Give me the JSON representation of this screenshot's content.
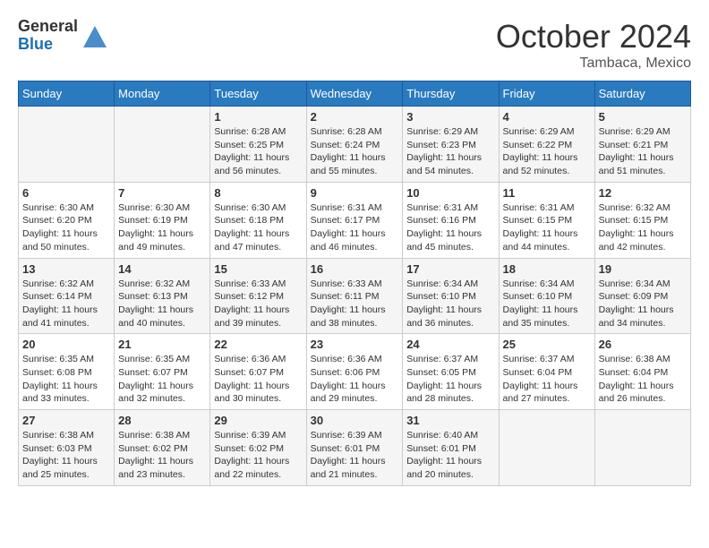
{
  "logo": {
    "general": "General",
    "blue": "Blue"
  },
  "title": "October 2024",
  "location": "Tambaca, Mexico",
  "days_of_week": [
    "Sunday",
    "Monday",
    "Tuesday",
    "Wednesday",
    "Thursday",
    "Friday",
    "Saturday"
  ],
  "weeks": [
    [
      {
        "day": "",
        "sunrise": "",
        "sunset": "",
        "daylight": ""
      },
      {
        "day": "",
        "sunrise": "",
        "sunset": "",
        "daylight": ""
      },
      {
        "day": "1",
        "sunrise": "Sunrise: 6:28 AM",
        "sunset": "Sunset: 6:25 PM",
        "daylight": "Daylight: 11 hours and 56 minutes."
      },
      {
        "day": "2",
        "sunrise": "Sunrise: 6:28 AM",
        "sunset": "Sunset: 6:24 PM",
        "daylight": "Daylight: 11 hours and 55 minutes."
      },
      {
        "day": "3",
        "sunrise": "Sunrise: 6:29 AM",
        "sunset": "Sunset: 6:23 PM",
        "daylight": "Daylight: 11 hours and 54 minutes."
      },
      {
        "day": "4",
        "sunrise": "Sunrise: 6:29 AM",
        "sunset": "Sunset: 6:22 PM",
        "daylight": "Daylight: 11 hours and 52 minutes."
      },
      {
        "day": "5",
        "sunrise": "Sunrise: 6:29 AM",
        "sunset": "Sunset: 6:21 PM",
        "daylight": "Daylight: 11 hours and 51 minutes."
      }
    ],
    [
      {
        "day": "6",
        "sunrise": "Sunrise: 6:30 AM",
        "sunset": "Sunset: 6:20 PM",
        "daylight": "Daylight: 11 hours and 50 minutes."
      },
      {
        "day": "7",
        "sunrise": "Sunrise: 6:30 AM",
        "sunset": "Sunset: 6:19 PM",
        "daylight": "Daylight: 11 hours and 49 minutes."
      },
      {
        "day": "8",
        "sunrise": "Sunrise: 6:30 AM",
        "sunset": "Sunset: 6:18 PM",
        "daylight": "Daylight: 11 hours and 47 minutes."
      },
      {
        "day": "9",
        "sunrise": "Sunrise: 6:31 AM",
        "sunset": "Sunset: 6:17 PM",
        "daylight": "Daylight: 11 hours and 46 minutes."
      },
      {
        "day": "10",
        "sunrise": "Sunrise: 6:31 AM",
        "sunset": "Sunset: 6:16 PM",
        "daylight": "Daylight: 11 hours and 45 minutes."
      },
      {
        "day": "11",
        "sunrise": "Sunrise: 6:31 AM",
        "sunset": "Sunset: 6:15 PM",
        "daylight": "Daylight: 11 hours and 44 minutes."
      },
      {
        "day": "12",
        "sunrise": "Sunrise: 6:32 AM",
        "sunset": "Sunset: 6:15 PM",
        "daylight": "Daylight: 11 hours and 42 minutes."
      }
    ],
    [
      {
        "day": "13",
        "sunrise": "Sunrise: 6:32 AM",
        "sunset": "Sunset: 6:14 PM",
        "daylight": "Daylight: 11 hours and 41 minutes."
      },
      {
        "day": "14",
        "sunrise": "Sunrise: 6:32 AM",
        "sunset": "Sunset: 6:13 PM",
        "daylight": "Daylight: 11 hours and 40 minutes."
      },
      {
        "day": "15",
        "sunrise": "Sunrise: 6:33 AM",
        "sunset": "Sunset: 6:12 PM",
        "daylight": "Daylight: 11 hours and 39 minutes."
      },
      {
        "day": "16",
        "sunrise": "Sunrise: 6:33 AM",
        "sunset": "Sunset: 6:11 PM",
        "daylight": "Daylight: 11 hours and 38 minutes."
      },
      {
        "day": "17",
        "sunrise": "Sunrise: 6:34 AM",
        "sunset": "Sunset: 6:10 PM",
        "daylight": "Daylight: 11 hours and 36 minutes."
      },
      {
        "day": "18",
        "sunrise": "Sunrise: 6:34 AM",
        "sunset": "Sunset: 6:10 PM",
        "daylight": "Daylight: 11 hours and 35 minutes."
      },
      {
        "day": "19",
        "sunrise": "Sunrise: 6:34 AM",
        "sunset": "Sunset: 6:09 PM",
        "daylight": "Daylight: 11 hours and 34 minutes."
      }
    ],
    [
      {
        "day": "20",
        "sunrise": "Sunrise: 6:35 AM",
        "sunset": "Sunset: 6:08 PM",
        "daylight": "Daylight: 11 hours and 33 minutes."
      },
      {
        "day": "21",
        "sunrise": "Sunrise: 6:35 AM",
        "sunset": "Sunset: 6:07 PM",
        "daylight": "Daylight: 11 hours and 32 minutes."
      },
      {
        "day": "22",
        "sunrise": "Sunrise: 6:36 AM",
        "sunset": "Sunset: 6:07 PM",
        "daylight": "Daylight: 11 hours and 30 minutes."
      },
      {
        "day": "23",
        "sunrise": "Sunrise: 6:36 AM",
        "sunset": "Sunset: 6:06 PM",
        "daylight": "Daylight: 11 hours and 29 minutes."
      },
      {
        "day": "24",
        "sunrise": "Sunrise: 6:37 AM",
        "sunset": "Sunset: 6:05 PM",
        "daylight": "Daylight: 11 hours and 28 minutes."
      },
      {
        "day": "25",
        "sunrise": "Sunrise: 6:37 AM",
        "sunset": "Sunset: 6:04 PM",
        "daylight": "Daylight: 11 hours and 27 minutes."
      },
      {
        "day": "26",
        "sunrise": "Sunrise: 6:38 AM",
        "sunset": "Sunset: 6:04 PM",
        "daylight": "Daylight: 11 hours and 26 minutes."
      }
    ],
    [
      {
        "day": "27",
        "sunrise": "Sunrise: 6:38 AM",
        "sunset": "Sunset: 6:03 PM",
        "daylight": "Daylight: 11 hours and 25 minutes."
      },
      {
        "day": "28",
        "sunrise": "Sunrise: 6:38 AM",
        "sunset": "Sunset: 6:02 PM",
        "daylight": "Daylight: 11 hours and 23 minutes."
      },
      {
        "day": "29",
        "sunrise": "Sunrise: 6:39 AM",
        "sunset": "Sunset: 6:02 PM",
        "daylight": "Daylight: 11 hours and 22 minutes."
      },
      {
        "day": "30",
        "sunrise": "Sunrise: 6:39 AM",
        "sunset": "Sunset: 6:01 PM",
        "daylight": "Daylight: 11 hours and 21 minutes."
      },
      {
        "day": "31",
        "sunrise": "Sunrise: 6:40 AM",
        "sunset": "Sunset: 6:01 PM",
        "daylight": "Daylight: 11 hours and 20 minutes."
      },
      {
        "day": "",
        "sunrise": "",
        "sunset": "",
        "daylight": ""
      },
      {
        "day": "",
        "sunrise": "",
        "sunset": "",
        "daylight": ""
      }
    ]
  ]
}
